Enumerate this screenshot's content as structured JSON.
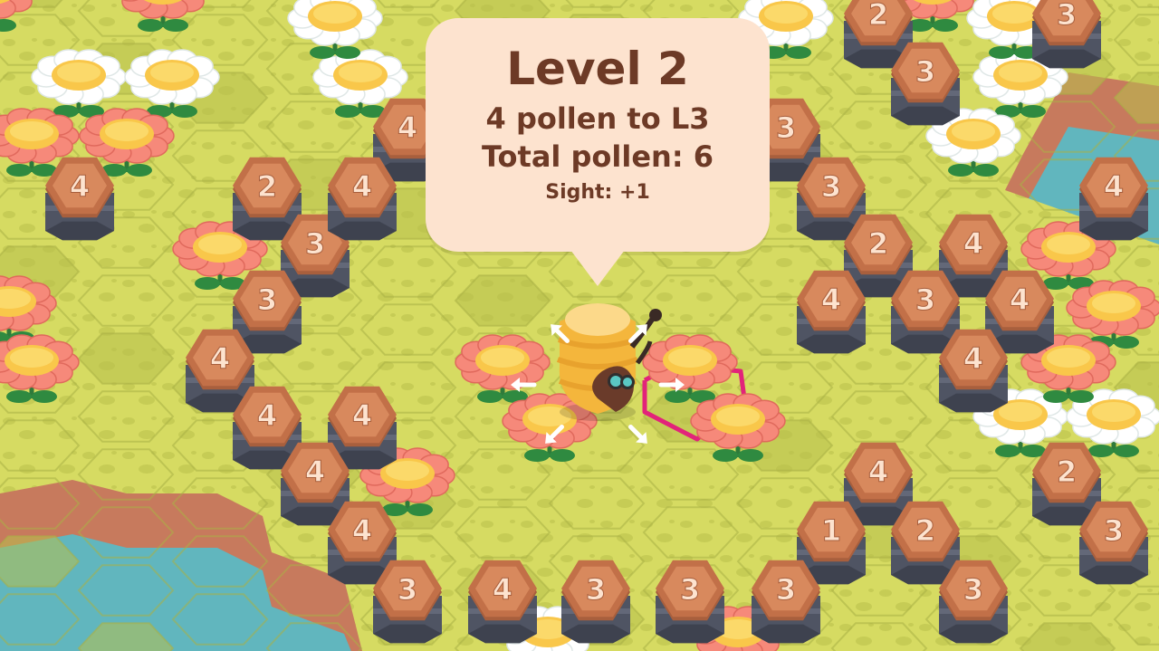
{
  "tooltip": {
    "title": "Level 2",
    "line1": "4 pollen to L3",
    "line2": "Total pollen: 6",
    "line3": "Sight: +1"
  },
  "colors": {
    "grass_light": "#d6db62",
    "grass_dark": "#b6bd4a",
    "water": "#61b6be",
    "tile_top": "#c27048",
    "tile_label_plate": "#d8895d",
    "tile_number": "#fde3cf",
    "tile_base": "#4f5463",
    "tooltip_bg": "#fde3cf",
    "tooltip_text": "#6d3a26",
    "highlight": "#e2237a"
  },
  "pollen_tiles": [
    {
      "label": "2"
    },
    {
      "label": "3"
    },
    {
      "label": "3"
    },
    {
      "label": "4"
    },
    {
      "label": "2"
    },
    {
      "label": "4"
    },
    {
      "label": "3"
    },
    {
      "label": "3"
    },
    {
      "label": "3"
    },
    {
      "label": "2"
    },
    {
      "label": "4"
    },
    {
      "label": "4"
    },
    {
      "label": "4"
    },
    {
      "label": "4"
    },
    {
      "label": "3"
    },
    {
      "label": "4"
    },
    {
      "label": "3"
    },
    {
      "label": "4"
    },
    {
      "label": "4"
    },
    {
      "label": "4"
    },
    {
      "label": "4"
    },
    {
      "label": "2"
    },
    {
      "label": "4"
    },
    {
      "label": "4"
    },
    {
      "label": "1"
    },
    {
      "label": "2"
    },
    {
      "label": "4"
    },
    {
      "label": "3"
    },
    {
      "label": "3"
    },
    {
      "label": "4"
    },
    {
      "label": "3"
    },
    {
      "label": "3"
    },
    {
      "label": "3"
    },
    {
      "label": "3"
    }
  ],
  "flowers": [
    {
      "type": "white"
    },
    {
      "type": "white"
    },
    {
      "type": "white"
    },
    {
      "type": "white"
    },
    {
      "type": "white"
    },
    {
      "type": "white"
    },
    {
      "type": "white"
    },
    {
      "type": "white"
    },
    {
      "type": "white"
    },
    {
      "type": "pink"
    },
    {
      "type": "pink"
    },
    {
      "type": "pink"
    },
    {
      "type": "pink"
    },
    {
      "type": "pink"
    },
    {
      "type": "pink"
    },
    {
      "type": "pink"
    },
    {
      "type": "pink"
    },
    {
      "type": "pink"
    },
    {
      "type": "pink"
    },
    {
      "type": "pink"
    },
    {
      "type": "pink"
    },
    {
      "type": "pink"
    },
    {
      "type": "pink"
    },
    {
      "type": "pink"
    },
    {
      "type": "pink"
    },
    {
      "type": "pink"
    },
    {
      "type": "white"
    },
    {
      "type": "white"
    }
  ],
  "move_arrows": [
    {
      "direction": "up-left"
    },
    {
      "direction": "up-right"
    },
    {
      "direction": "left"
    },
    {
      "direction": "right"
    },
    {
      "direction": "down-left"
    },
    {
      "direction": "down-right"
    }
  ]
}
